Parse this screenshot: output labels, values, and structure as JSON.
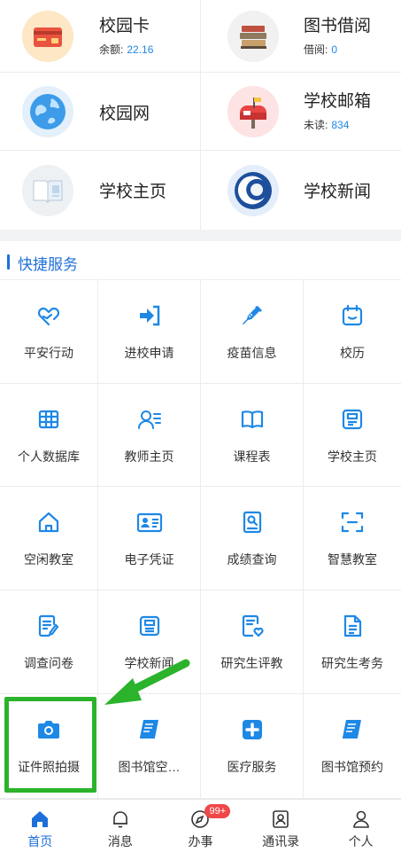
{
  "tiles": [
    {
      "title": "校园卡",
      "sub_label": "余额:",
      "sub_value": "22.16",
      "icon": "campus-card-icon"
    },
    {
      "title": "图书借阅",
      "sub_label": "借阅:",
      "sub_value": "0",
      "icon": "books-icon"
    },
    {
      "title": "校园网",
      "sub_label": "",
      "sub_value": "",
      "icon": "globe-icon"
    },
    {
      "title": "学校邮箱",
      "sub_label": "未读:",
      "sub_value": "834",
      "icon": "mailbox-icon"
    },
    {
      "title": "学校主页",
      "sub_label": "",
      "sub_value": "",
      "icon": "open-book-icon"
    },
    {
      "title": "学校新闻",
      "sub_label": "",
      "sub_value": "",
      "icon": "news-logo-icon"
    }
  ],
  "section": {
    "title": "快捷服务"
  },
  "services": [
    {
      "label": "平安行动",
      "icon": "heart-hand-icon"
    },
    {
      "label": "进校申请",
      "icon": "enter-icon"
    },
    {
      "label": "疫苗信息",
      "icon": "syringe-icon"
    },
    {
      "label": "校历",
      "icon": "calendar-icon"
    },
    {
      "label": "个人数据库",
      "icon": "table-icon"
    },
    {
      "label": "教师主页",
      "icon": "teacher-icon"
    },
    {
      "label": "课程表",
      "icon": "open-book-icon"
    },
    {
      "label": "学校主页",
      "icon": "document-icon"
    },
    {
      "label": "空闲教室",
      "icon": "home-icon"
    },
    {
      "label": "电子凭证",
      "icon": "id-card-icon"
    },
    {
      "label": "成绩查询",
      "icon": "search-doc-icon"
    },
    {
      "label": "智慧教室",
      "icon": "scan-icon"
    },
    {
      "label": "调查问卷",
      "icon": "survey-icon"
    },
    {
      "label": "学校新闻",
      "icon": "news-icon"
    },
    {
      "label": "研究生评教",
      "icon": "review-icon"
    },
    {
      "label": "研究生考务",
      "icon": "file-icon"
    },
    {
      "label": "证件照拍摄",
      "icon": "camera-icon"
    },
    {
      "label": "图书馆空…",
      "icon": "book-icon"
    },
    {
      "label": "医疗服务",
      "icon": "medical-icon"
    },
    {
      "label": "图书馆预约",
      "icon": "book-icon"
    }
  ],
  "nav": [
    {
      "label": "首页",
      "icon": "home-icon",
      "active": true
    },
    {
      "label": "消息",
      "icon": "bell-icon"
    },
    {
      "label": "办事",
      "icon": "compass-icon",
      "badge": "99+"
    },
    {
      "label": "通讯录",
      "icon": "contacts-icon"
    },
    {
      "label": "个人",
      "icon": "person-icon"
    }
  ],
  "colors": {
    "accent": "#1e6fd9",
    "highlight": "#2bb32b",
    "badge": "#f04848"
  }
}
